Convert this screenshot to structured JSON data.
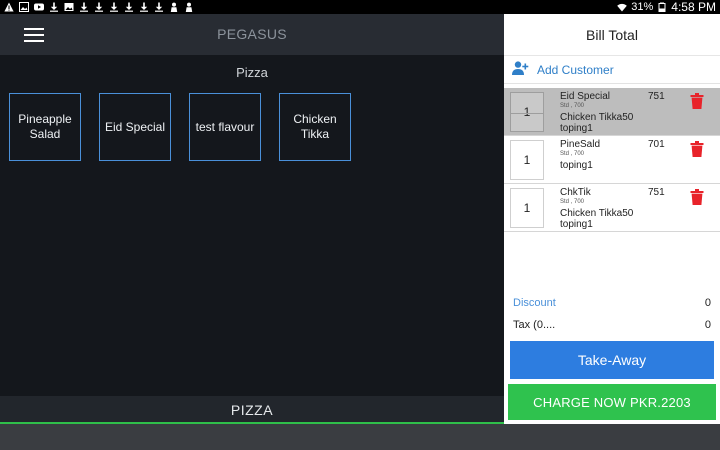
{
  "status_bar": {
    "icons": [
      "warning-icon",
      "image-icon",
      "youtube-icon",
      "download-icon",
      "gallery-icon",
      "download-icon",
      "download-icon",
      "download-icon",
      "download-icon",
      "download-icon",
      "download-icon",
      "person-icon",
      "person-icon"
    ],
    "battery": "31%",
    "time": "4:58 PM"
  },
  "header": {
    "title": "PEGASUS"
  },
  "category": {
    "title": "Pizza",
    "footer_label": "PIZZA"
  },
  "items": [
    "Pineapple Salad",
    "Eid Special",
    "test flavour",
    "Chicken Tikka"
  ],
  "bill": {
    "title": "Bill Total",
    "add_customer": "Add Customer",
    "rows": [
      {
        "qty": "1",
        "name": "Eid Special",
        "sub": "Std , 700",
        "line3": "Chicken Tikka50",
        "line4": "toping1",
        "price": "751"
      },
      {
        "qty": "1",
        "name": "PineSald",
        "sub": "Std , 700",
        "line3": "toping1",
        "line4": "",
        "price": "701"
      },
      {
        "qty": "1",
        "name": "ChkTik",
        "sub": "Std , 700",
        "line3": "Chicken Tikka50",
        "line4": "toping1",
        "price": "751"
      }
    ],
    "discount_label": "Discount",
    "discount_value": "0",
    "tax_label": "Tax (0....",
    "tax_value": "0",
    "takeaway": "Take-Away",
    "charge": "CHARGE NOW PKR.2203"
  },
  "colors": {
    "accent_blue": "#2d7de0",
    "charge_green": "#2fc24e",
    "delete_red": "#e8232a",
    "item_border": "#4a90d9"
  }
}
